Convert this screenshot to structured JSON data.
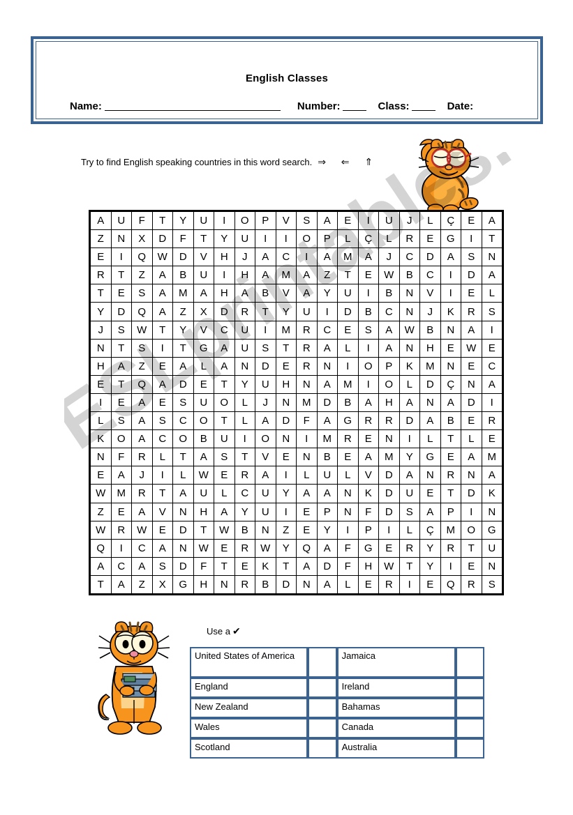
{
  "header": {
    "title": "English Classes",
    "name_label": "Name:",
    "number_label": "Number:",
    "class_label": "Class:",
    "date_label": "Date:",
    "border_color": "#3a6392"
  },
  "instruction": {
    "text": "Try to find English speaking countries in this word search.",
    "arrows": "⇒  ⇐  ⇑"
  },
  "images": {
    "garfield_waving": "garfield-waving-image",
    "garfield_books": "garfield-holding-books-image"
  },
  "wordsearch": {
    "columns": 20,
    "rows_count": 21,
    "rows": [
      [
        "A",
        "U",
        "F",
        "T",
        "Y",
        "U",
        "I",
        "O",
        "P",
        "V",
        "S",
        "A",
        "E",
        "I",
        "U",
        "J",
        "L",
        "Ç",
        "E",
        "A"
      ],
      [
        "Z",
        "N",
        "X",
        "D",
        "F",
        "T",
        "Y",
        "U",
        "I",
        "I",
        "O",
        "P",
        "L",
        "Ç",
        "L",
        "R",
        "E",
        "G",
        "I",
        "T"
      ],
      [
        "E",
        "I",
        "Q",
        "W",
        "D",
        "V",
        "H",
        "J",
        "A",
        "C",
        "I",
        "A",
        "M",
        "A",
        "J",
        "C",
        "D",
        "A",
        "S",
        "N"
      ],
      [
        "R",
        "T",
        "Z",
        "A",
        "B",
        "U",
        "I",
        "H",
        "A",
        "M",
        "A",
        "Z",
        "T",
        "E",
        "W",
        "B",
        "C",
        "I",
        "D",
        "A"
      ],
      [
        "T",
        "E",
        "S",
        "A",
        "M",
        "A",
        "H",
        "A",
        "B",
        "V",
        "A",
        "Y",
        "U",
        "I",
        "B",
        "N",
        "V",
        "I",
        "E",
        "L"
      ],
      [
        "Y",
        "D",
        "Q",
        "A",
        "Z",
        "X",
        "D",
        "R",
        "T",
        "Y",
        "U",
        "I",
        "D",
        "B",
        "C",
        "N",
        "J",
        "K",
        "R",
        "S"
      ],
      [
        "J",
        "S",
        "W",
        "T",
        "Y",
        "V",
        "C",
        "U",
        "I",
        "M",
        "R",
        "C",
        "E",
        "S",
        "A",
        "W",
        "B",
        "N",
        "A",
        "I"
      ],
      [
        "N",
        "T",
        "S",
        "I",
        "T",
        "G",
        "A",
        "U",
        "S",
        "T",
        "R",
        "A",
        "L",
        "I",
        "A",
        "N",
        "H",
        "E",
        "W",
        "E"
      ],
      [
        "H",
        "A",
        "Z",
        "E",
        "A",
        "L",
        "A",
        "N",
        "D",
        "E",
        "R",
        "N",
        "I",
        "O",
        "P",
        "K",
        "M",
        "N",
        "E",
        "C"
      ],
      [
        "E",
        "T",
        "Q",
        "A",
        "D",
        "E",
        "T",
        "Y",
        "U",
        "H",
        "N",
        "A",
        "M",
        "I",
        "O",
        "L",
        "D",
        "Ç",
        "N",
        "A"
      ],
      [
        "I",
        "E",
        "A",
        "E",
        "S",
        "U",
        "O",
        "L",
        "J",
        "N",
        "M",
        "D",
        "B",
        "A",
        "H",
        "A",
        "N",
        "A",
        "D",
        "I"
      ],
      [
        "L",
        "S",
        "A",
        "S",
        "C",
        "O",
        "T",
        "L",
        "A",
        "D",
        "F",
        "A",
        "G",
        "R",
        "R",
        "D",
        "A",
        "B",
        "E",
        "R"
      ],
      [
        "K",
        "O",
        "A",
        "C",
        "O",
        "B",
        "U",
        "I",
        "O",
        "N",
        "I",
        "M",
        "R",
        "E",
        "N",
        "I",
        "L",
        "T",
        "L",
        "E"
      ],
      [
        "N",
        "F",
        "R",
        "L",
        "T",
        "A",
        "S",
        "T",
        "V",
        "E",
        "N",
        "B",
        "E",
        "A",
        "M",
        "Y",
        "G",
        "E",
        "A",
        "M"
      ],
      [
        "E",
        "A",
        "J",
        "I",
        "L",
        "W",
        "E",
        "R",
        "A",
        "I",
        "L",
        "U",
        "L",
        "V",
        "D",
        "A",
        "N",
        "R",
        "N",
        "A"
      ],
      [
        "W",
        "M",
        "R",
        "T",
        "A",
        "U",
        "L",
        "C",
        "U",
        "Y",
        "A",
        "A",
        "N",
        "K",
        "D",
        "U",
        "E",
        "T",
        "D",
        "K"
      ],
      [
        "Z",
        "E",
        "A",
        "V",
        "N",
        "H",
        "A",
        "Y",
        "U",
        "I",
        "E",
        "P",
        "N",
        "F",
        "D",
        "S",
        "A",
        "P",
        "I",
        "N"
      ],
      [
        "W",
        "R",
        "W",
        "E",
        "D",
        "T",
        "W",
        "B",
        "N",
        "Z",
        "E",
        "Y",
        "I",
        "P",
        "I",
        "L",
        "Ç",
        "M",
        "O",
        "G"
      ],
      [
        "Q",
        "I",
        "C",
        "A",
        "N",
        "W",
        "E",
        "R",
        "W",
        "Y",
        "Q",
        "A",
        "F",
        "G",
        "E",
        "R",
        "Y",
        "R",
        "T",
        "U"
      ],
      [
        "A",
        "C",
        "A",
        "S",
        "D",
        "F",
        "T",
        "E",
        "K",
        "T",
        "A",
        "D",
        "F",
        "H",
        "W",
        "T",
        "Y",
        "I",
        "E",
        "N"
      ],
      [
        "T",
        "A",
        "Z",
        "X",
        "G",
        "H",
        "N",
        "R",
        "B",
        "D",
        "N",
        "A",
        "L",
        "E",
        "R",
        "I",
        "E",
        "Q",
        "R",
        "S"
      ]
    ]
  },
  "use_a": {
    "label": "Use a",
    "check": "✔"
  },
  "answers": {
    "rows": [
      {
        "left": "United States of America",
        "right": "Jamaica"
      },
      {
        "left": "England",
        "right": "Ireland"
      },
      {
        "left": "New Zealand",
        "right": "Bahamas"
      },
      {
        "left": "Wales",
        "right": "Canada"
      },
      {
        "left": "Scotland",
        "right": "Australia"
      }
    ]
  },
  "watermark": {
    "text": "ESLprintables.com"
  }
}
